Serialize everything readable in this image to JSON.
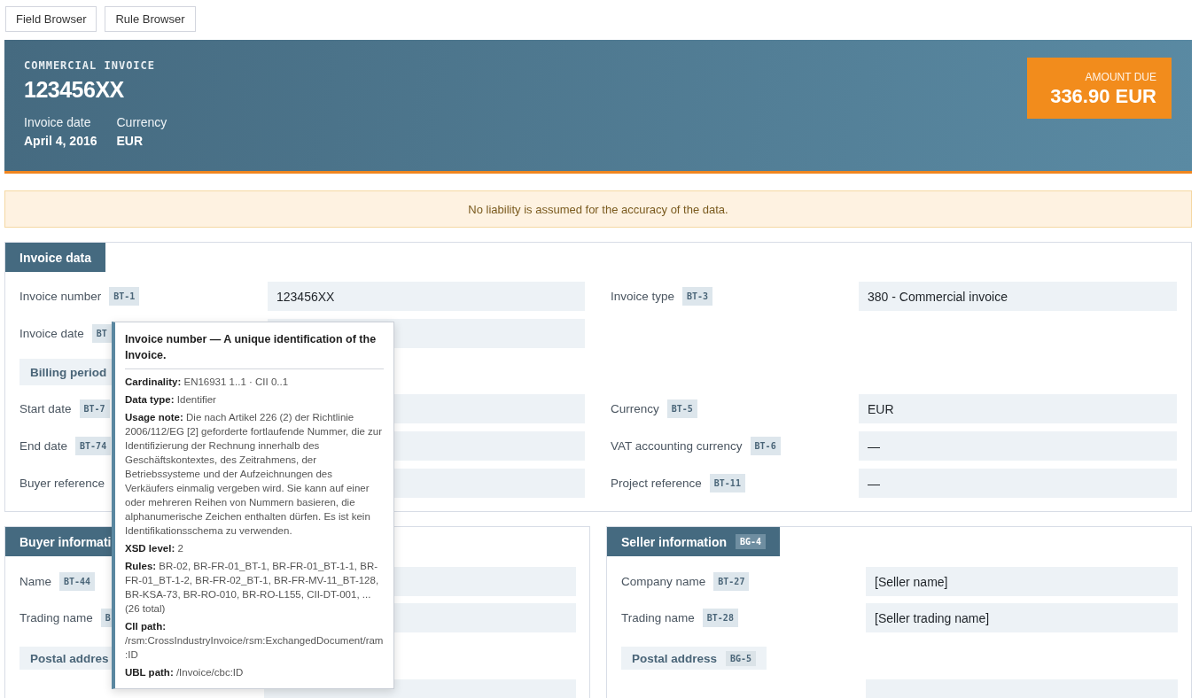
{
  "toolbar": {
    "buttons": [
      "Field Browser",
      "Rule Browser"
    ]
  },
  "header": {
    "doc_type": "COMMERCIAL INVOICE",
    "number": "123456XX",
    "meta": [
      {
        "label": "Invoice date",
        "value": "April 4, 2016"
      },
      {
        "label": "Currency",
        "value": "EUR"
      }
    ],
    "amount_label": "AMOUNT DUE",
    "amount": "336.90 EUR"
  },
  "notice": "No liability is assumed for the accuracy of the data.",
  "invoice_data": {
    "title": "Invoice data",
    "rows": [
      {
        "left": {
          "kind": "field",
          "label": "Invoice number",
          "badge": "BT-1",
          "value": "123456XX"
        },
        "right": {
          "kind": "field",
          "label": "Invoice type",
          "badge": "BT-3",
          "value": "380 - Commercial invoice"
        }
      },
      {
        "left": {
          "kind": "field",
          "label": "Invoice date",
          "badge": "BT"
        }
      },
      {
        "left": {
          "kind": "group",
          "label": "Billing period"
        }
      },
      {
        "left": {
          "kind": "field",
          "label": "Start date",
          "badge": "BT-7"
        },
        "right": {
          "kind": "field",
          "label": "Currency",
          "badge": "BT-5",
          "value": "EUR"
        }
      },
      {
        "left": {
          "kind": "field",
          "label": "End date",
          "badge": "BT-74"
        },
        "right": {
          "kind": "field",
          "label": "VAT accounting currency",
          "badge": "BT-6",
          "value": "—"
        }
      },
      {
        "left": {
          "kind": "field",
          "label": "Buyer reference"
        },
        "right": {
          "kind": "field",
          "label": "Project reference",
          "badge": "BT-11",
          "value": "—"
        }
      }
    ]
  },
  "panels": [
    {
      "title": "Buyer informati",
      "rows": [
        {
          "kind": "field",
          "label": "Name",
          "badge": "BT-44"
        },
        {
          "kind": "field",
          "label": "Trading name",
          "badge": "B"
        },
        {
          "kind": "group",
          "label": "Postal addres"
        },
        {
          "kind": "field"
        }
      ]
    },
    {
      "title": "Seller information",
      "badge": "BG-4",
      "rows": [
        {
          "kind": "field",
          "label": "Company name",
          "badge": "BT-27",
          "value": "[Seller name]"
        },
        {
          "kind": "field",
          "label": "Trading name",
          "badge": "BT-28",
          "value": "[Seller trading name]"
        },
        {
          "kind": "group",
          "label": "Postal address",
          "badge": "BG-5"
        },
        {
          "kind": "field"
        }
      ]
    }
  ],
  "tooltip": {
    "title": "Invoice number — A unique identification of the Invoice.",
    "entries": [
      {
        "label": "Cardinality:",
        "value": "EN16931 1..1 · CII 0..1"
      },
      {
        "label": "Data type:",
        "value": "Identifier"
      },
      {
        "label": "Usage note:",
        "value": "Die nach Artikel 226 (2) der Richtlinie 2006/112/EG [2] geforderte fortlaufende Nummer, die zur Identifizierung der Rechnung innerhalb des Geschäftskontextes, des Zeitrahmens, der Betriebssysteme und der Aufzeichnungen des Verkäufers einmalig vergeben wird. Sie kann auf einer oder mehreren Reihen von Nummern basieren, die alphanumerische Zeichen enthalten dürfen. Es ist kein Identifikationsschema zu verwenden."
      },
      {
        "label": "XSD level:",
        "value": "2"
      },
      {
        "label": "Rules:",
        "value": "BR-02, BR-FR-01_BT-1, BR-FR-01_BT-1-1, BR-FR-01_BT-1-2, BR-FR-02_BT-1, BR-FR-MV-11_BT-128, BR-KSA-73, BR-RO-010, BR-RO-L155, CII-DT-001, ... (26 total)"
      },
      {
        "label": "CII path:",
        "value": "/rsm:CrossIndustryInvoice/rsm:ExchangedDocument/ram:ID"
      },
      {
        "label": "UBL path:",
        "value": "/Invoice/cbc:ID"
      }
    ]
  }
}
